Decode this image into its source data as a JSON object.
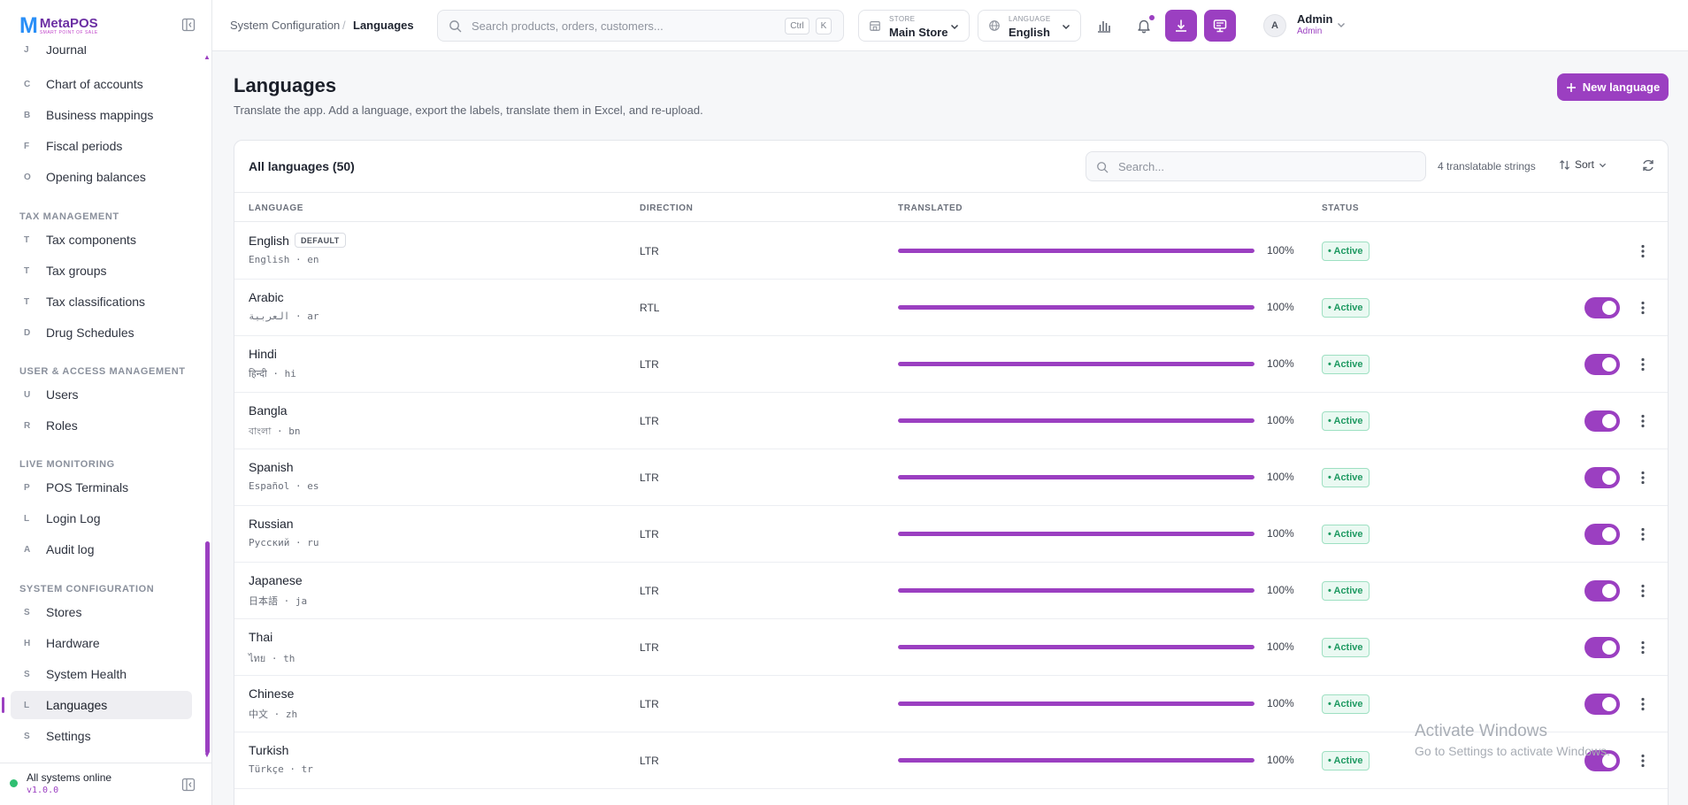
{
  "brand": {
    "logo_letters": "M",
    "name": "MetaPOS",
    "tagline": "SMART POINT OF SALE"
  },
  "sidebar": {
    "sections": [
      {
        "key": "tax",
        "label": "TAX MANAGEMENT"
      },
      {
        "key": "users",
        "label": "USER & ACCESS MANAGEMENT"
      },
      {
        "key": "live",
        "label": "LIVE MONITORING"
      },
      {
        "key": "sys",
        "label": "SYSTEM CONFIGURATION"
      }
    ],
    "items": [
      {
        "letter": "J",
        "label": "Journal"
      },
      {
        "letter": "C",
        "label": "Chart of accounts"
      },
      {
        "letter": "B",
        "label": "Business mappings"
      },
      {
        "letter": "F",
        "label": "Fiscal periods"
      },
      {
        "letter": "O",
        "label": "Opening balances"
      },
      {
        "letter": "T",
        "label": "Tax components"
      },
      {
        "letter": "T",
        "label": "Tax groups"
      },
      {
        "letter": "T",
        "label": "Tax classifications"
      },
      {
        "letter": "D",
        "label": "Drug Schedules"
      },
      {
        "letter": "U",
        "label": "Users"
      },
      {
        "letter": "R",
        "label": "Roles"
      },
      {
        "letter": "P",
        "label": "POS Terminals"
      },
      {
        "letter": "L",
        "label": "Login Log"
      },
      {
        "letter": "A",
        "label": "Audit log"
      },
      {
        "letter": "S",
        "label": "Stores"
      },
      {
        "letter": "H",
        "label": "Hardware"
      },
      {
        "letter": "S",
        "label": "System Health"
      },
      {
        "letter": "L",
        "label": "Languages"
      },
      {
        "letter": "S",
        "label": "Settings"
      }
    ],
    "active_item": "Languages",
    "footer": {
      "status": "All systems online",
      "version": "v1.0.0"
    }
  },
  "topbar": {
    "breadcrumb": {
      "parent": "System Configuration",
      "separator": "/",
      "current": "Languages"
    },
    "search": {
      "placeholder": "Search products, orders, customers...",
      "kbd1": "Ctrl",
      "kbd2": "K"
    },
    "store": {
      "caption": "STORE",
      "value": "Main Store"
    },
    "language": {
      "caption": "LANGUAGE",
      "value": "English"
    },
    "user": {
      "initial": "A",
      "name": "Admin",
      "role": "Admin"
    },
    "icons": [
      "chart-icon",
      "bell-icon",
      "download-icon",
      "pos-terminal-icon"
    ]
  },
  "page": {
    "title": "Languages",
    "subtitle": "Translate the app. Add a language, export the labels, translate them in Excel, and re-upload.",
    "new_button": "New language"
  },
  "table": {
    "title": "All languages (50)",
    "search_placeholder": "Search...",
    "strings_count": "4 translatable strings",
    "sort_label": "Sort",
    "columns": [
      "LANGUAGE",
      "DIRECTION",
      "TRANSLATED",
      "STATUS"
    ],
    "default_badge": "DEFAULT",
    "rows": [
      {
        "name": "English",
        "meta": "English · en",
        "direction": "LTR",
        "percent": 100,
        "percent_label": "100%",
        "status": "• Active",
        "is_default": true,
        "enabled": true
      },
      {
        "name": "Arabic",
        "meta": "العربية · ar",
        "direction": "RTL",
        "percent": 100,
        "percent_label": "100%",
        "status": "• Active",
        "is_default": false,
        "enabled": true
      },
      {
        "name": "Hindi",
        "meta": "हिन्दी · hi",
        "direction": "LTR",
        "percent": 100,
        "percent_label": "100%",
        "status": "• Active",
        "is_default": false,
        "enabled": true
      },
      {
        "name": "Bangla",
        "meta": "বাংলা · bn",
        "direction": "LTR",
        "percent": 100,
        "percent_label": "100%",
        "status": "• Active",
        "is_default": false,
        "enabled": true
      },
      {
        "name": "Spanish",
        "meta": "Español · es",
        "direction": "LTR",
        "percent": 100,
        "percent_label": "100%",
        "status": "• Active",
        "is_default": false,
        "enabled": true
      },
      {
        "name": "Russian",
        "meta": "Русский · ru",
        "direction": "LTR",
        "percent": 100,
        "percent_label": "100%",
        "status": "• Active",
        "is_default": false,
        "enabled": true
      },
      {
        "name": "Japanese",
        "meta": "日本語 · ja",
        "direction": "LTR",
        "percent": 100,
        "percent_label": "100%",
        "status": "• Active",
        "is_default": false,
        "enabled": true
      },
      {
        "name": "Thai",
        "meta": "ไทย · th",
        "direction": "LTR",
        "percent": 100,
        "percent_label": "100%",
        "status": "• Active",
        "is_default": false,
        "enabled": true
      },
      {
        "name": "Chinese",
        "meta": "中文 · zh",
        "direction": "LTR",
        "percent": 100,
        "percent_label": "100%",
        "status": "• Active",
        "is_default": false,
        "enabled": true
      },
      {
        "name": "Turkish",
        "meta": "Türkçe · tr",
        "direction": "LTR",
        "percent": 100,
        "percent_label": "100%",
        "status": "• Active",
        "is_default": false,
        "enabled": true
      }
    ]
  },
  "watermark": {
    "line1": "Activate Windows",
    "line2": "Go to Settings to activate Windows."
  },
  "colors": {
    "accent": "#9b3fc1",
    "success": "#1f9a62",
    "success_bg": "#eaf9f2"
  }
}
